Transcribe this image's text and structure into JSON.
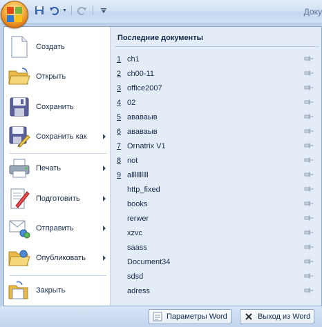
{
  "window": {
    "title": "Доку"
  },
  "quick_access": [
    {
      "name": "save-icon"
    },
    {
      "name": "undo-icon"
    },
    {
      "name": "redo-icon"
    },
    {
      "name": "customize-icon"
    }
  ],
  "commands": [
    {
      "label": "Создать",
      "icon": "new-document-icon",
      "submenu": false
    },
    {
      "label": "Открыть",
      "icon": "open-folder-icon",
      "submenu": false
    },
    {
      "label": "Сохранить",
      "icon": "save-icon",
      "submenu": false
    },
    {
      "label": "Сохранить как",
      "icon": "save-as-icon",
      "submenu": true
    },
    {
      "label": "Печать",
      "icon": "printer-icon",
      "submenu": true
    },
    {
      "label": "Подготовить",
      "icon": "prepare-icon",
      "submenu": true
    },
    {
      "label": "Отправить",
      "icon": "send-icon",
      "submenu": true
    },
    {
      "label": "Опубликовать",
      "icon": "publish-icon",
      "submenu": true
    },
    {
      "label": "Закрыть",
      "icon": "close-folder-icon",
      "submenu": false
    }
  ],
  "recent": {
    "title": "Последние документы",
    "documents": [
      {
        "num": "1",
        "name": "ch1"
      },
      {
        "num": "2",
        "name": "ch00-11"
      },
      {
        "num": "3",
        "name": "office2007"
      },
      {
        "num": "4",
        "name": "02"
      },
      {
        "num": "5",
        "name": "ававаыв"
      },
      {
        "num": "6",
        "name": "ававаыв"
      },
      {
        "num": "7",
        "name": "Ornatrix V1"
      },
      {
        "num": "8",
        "name": "not"
      },
      {
        "num": "9",
        "name": "allllllllll"
      },
      {
        "num": "",
        "name": "http_fixed"
      },
      {
        "num": "",
        "name": "books"
      },
      {
        "num": "",
        "name": "rerwer"
      },
      {
        "num": "",
        "name": "xzvc"
      },
      {
        "num": "",
        "name": "saass"
      },
      {
        "num": "",
        "name": "Document34"
      },
      {
        "num": "",
        "name": "sdsd"
      },
      {
        "num": "",
        "name": "adress"
      }
    ]
  },
  "footer": {
    "options_label": "Параметры Word",
    "exit_label": "Выход из Word"
  }
}
